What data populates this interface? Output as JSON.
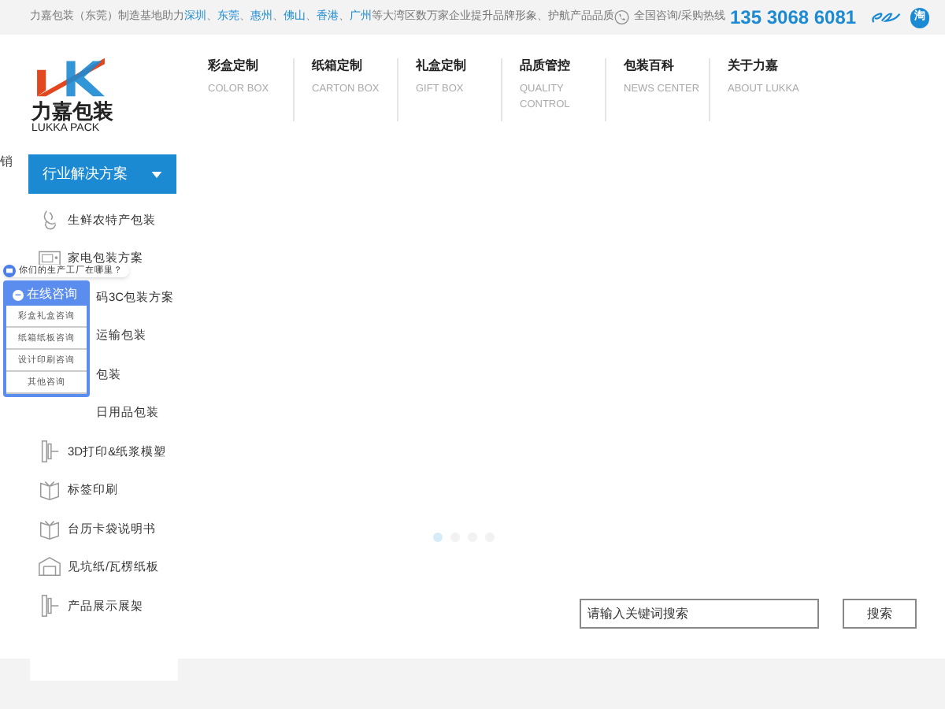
{
  "top_bar": {
    "segments": [
      {
        "text": "力嘉包装（东莞）制造基地助力",
        "link": false
      },
      {
        "text": "深圳",
        "link": true
      },
      {
        "text": "、",
        "link": false
      },
      {
        "text": "东莞",
        "link": true
      },
      {
        "text": "、",
        "link": false
      },
      {
        "text": "惠州",
        "link": true
      },
      {
        "text": "、",
        "link": false
      },
      {
        "text": "佛山",
        "link": true
      },
      {
        "text": "、",
        "link": false
      },
      {
        "text": "香港",
        "link": true
      },
      {
        "text": "、",
        "link": false
      },
      {
        "text": "广州",
        "link": true
      },
      {
        "text": "等大湾区数万家企业提升品牌形象、护航产品品质",
        "link": false
      }
    ],
    "hotline_label": "全国咨询/采购热线",
    "phone": "135 3068 6081",
    "taobao": "淘"
  },
  "logo": {
    "name": "力嘉包装",
    "subtitle": "LUKKA PACK"
  },
  "nav": [
    {
      "label": "彩盒定制",
      "sub": "COLOR BOX"
    },
    {
      "label": "纸箱定制",
      "sub": "CARTON BOX"
    },
    {
      "label": "礼盒定制",
      "sub": "GIFT BOX"
    },
    {
      "label": "品质管控",
      "sub": "QUALITY CONTROL"
    },
    {
      "label": "包装百科",
      "sub": "NEWS CENTER"
    },
    {
      "label": "关于力嘉",
      "sub": "ABOUT LUKKA"
    }
  ],
  "left_edge_text": "销",
  "solutions": {
    "title": "行业解决方案",
    "items": [
      {
        "label": "生鲜农特产包装",
        "kind": "leaf"
      },
      {
        "label": "家电包装方案",
        "kind": "appliance"
      },
      {
        "label": "码3C包装方案",
        "kind": "covered"
      },
      {
        "label": "运输包装",
        "kind": "covered"
      },
      {
        "label": "包装",
        "kind": "covered"
      },
      {
        "label": "日用品包装",
        "kind": "covered"
      },
      {
        "label": "3D打印&纸浆模塑",
        "kind": "mold"
      },
      {
        "label": "标签印刷",
        "kind": "book"
      },
      {
        "label": "台历卡袋说明书",
        "kind": "book"
      },
      {
        "label": "见坑纸/瓦楞纸板",
        "kind": "box"
      },
      {
        "label": "产品展示展架",
        "kind": "mold"
      }
    ]
  },
  "chat": {
    "bubble": "你们的生产工厂在哪里？",
    "title": "在线咨询",
    "options": [
      "彩盒礼盒咨询",
      "纸箱纸板咨询",
      "设计印刷咨询",
      "其他咨询"
    ]
  },
  "slider_dots": [
    {
      "selected": true
    },
    {
      "selected": false
    },
    {
      "selected": false
    },
    {
      "selected": false
    }
  ],
  "search": {
    "placeholder": "请输入关键词搜索",
    "button": "搜索"
  }
}
